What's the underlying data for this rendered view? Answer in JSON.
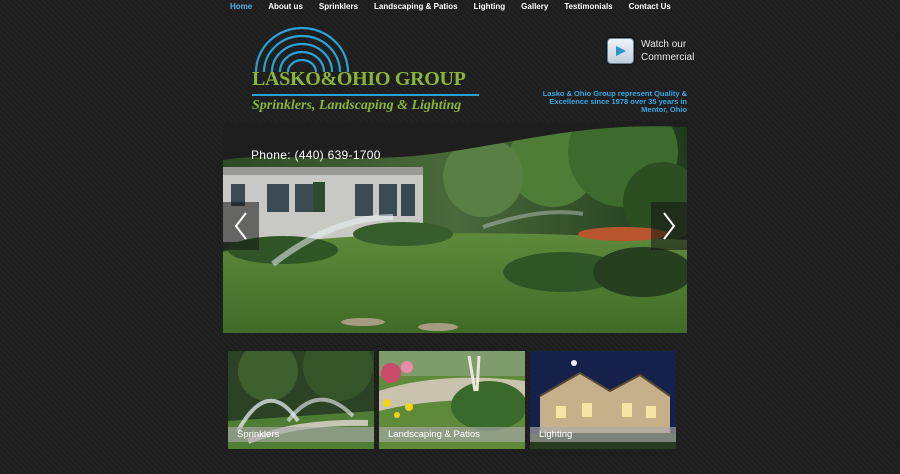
{
  "nav": {
    "items": [
      {
        "label": "Home",
        "active": true
      },
      {
        "label": "About us",
        "active": false
      },
      {
        "label": "Sprinklers",
        "active": false
      },
      {
        "label": "Landscaping & Patios",
        "active": false
      },
      {
        "label": "Lighting",
        "active": false
      },
      {
        "label": "Gallery",
        "active": false
      },
      {
        "label": "Testimonials",
        "active": false
      },
      {
        "label": "Contact Us",
        "active": false
      }
    ]
  },
  "logo": {
    "brand": "LASKO&OHIO GROUP",
    "tagline": "Sprinklers, Landscaping & Lighting"
  },
  "commercial": {
    "line1": "Watch our",
    "line2": "Commercial",
    "icon": "play-icon"
  },
  "about_text": "Lasko & Ohio Group represent Quality & Excellence since 1978 over 35 years in Mentor, Ohio",
  "hero": {
    "phone": "Phone: (440) 639-1700",
    "prev_icon": "chevron-left-icon",
    "next_icon": "chevron-right-icon"
  },
  "tiles": [
    {
      "label": "Sprinklers"
    },
    {
      "label": "Landscaping & Patios"
    },
    {
      "label": "Lighting"
    }
  ],
  "colors": {
    "background": "#1e1e1e",
    "nav_active": "#4fb3e3",
    "brand_green": "#8ab53a",
    "brand_blue": "#2ba1d6"
  }
}
